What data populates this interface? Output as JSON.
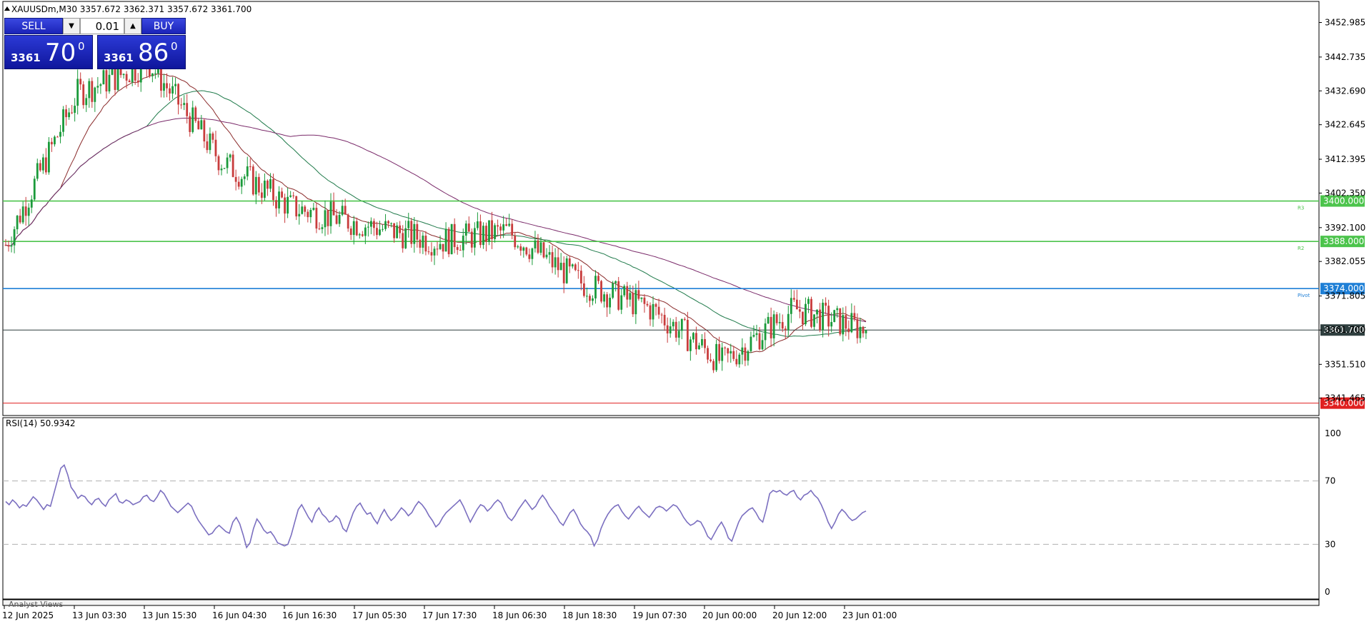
{
  "header": {
    "symbol_line": "XAUUSDm,M30  3357.672 3362.371 3357.672 3361.700",
    "collapse_icon": "triangle-up-icon"
  },
  "trade_panel": {
    "sell_label": "SELL",
    "buy_label": "BUY",
    "lot_value": "0.01",
    "sell_price_small": "3361",
    "sell_price_big": "70",
    "sell_price_sup": "0",
    "buy_price_small": "3361",
    "buy_price_big": "86",
    "buy_price_sup": "0"
  },
  "price_axis": {
    "ticks": [
      "3452.985",
      "3442.735",
      "3432.690",
      "3422.645",
      "3412.395",
      "3402.350",
      "3392.100",
      "3382.055",
      "3371.805",
      "3361.700",
      "3351.510",
      "3341.465"
    ],
    "tick_values": [
      3452.985,
      3442.735,
      3432.69,
      3422.645,
      3412.395,
      3402.35,
      3392.1,
      3382.055,
      3371.805,
      3361.7,
      3351.51,
      3341.465
    ]
  },
  "levels": [
    {
      "value": 3400.0,
      "label": "3400.000",
      "color": "#4cc44c",
      "tag": "R3"
    },
    {
      "value": 3388.0,
      "label": "3388.000",
      "color": "#4cc44c",
      "tag": "R2"
    },
    {
      "value": 3374.0,
      "label": "3374.000",
      "color": "#1e7fd6",
      "tag": "Pivot"
    },
    {
      "value": 3361.7,
      "label": "3361.700",
      "color": "#2f3f3f",
      "tag": ""
    },
    {
      "value": 3340.0,
      "label": "3340.000",
      "color": "#e02020",
      "tag": ""
    }
  ],
  "rsi": {
    "title": "RSI(14) 50.9342",
    "ticks": [
      "100",
      "70",
      "30",
      "0"
    ],
    "line_color": "#7b6fc0",
    "values": [
      57,
      55,
      58,
      56,
      53,
      55,
      54,
      57,
      60,
      58,
      55,
      52,
      55,
      54,
      62,
      70,
      78,
      80,
      74,
      66,
      63,
      59,
      61,
      60,
      57,
      55,
      58,
      59,
      56,
      54,
      58,
      60,
      62,
      57,
      56,
      58,
      57,
      55,
      56,
      57,
      60,
      61,
      58,
      57,
      60,
      64,
      62,
      58,
      54,
      52,
      50,
      52,
      54,
      56,
      54,
      49,
      45,
      42,
      39,
      36,
      37,
      40,
      42,
      40,
      38,
      37,
      44,
      47,
      43,
      36,
      28,
      31,
      40,
      46,
      43,
      39,
      37,
      38,
      35,
      31,
      30,
      29,
      30,
      36,
      44,
      52,
      55,
      51,
      47,
      44,
      50,
      53,
      49,
      47,
      44,
      45,
      48,
      46,
      40,
      38,
      44,
      50,
      54,
      56,
      52,
      49,
      50,
      46,
      43,
      48,
      52,
      48,
      45,
      47,
      50,
      53,
      51,
      48,
      50,
      54,
      57,
      55,
      52,
      48,
      45,
      41,
      43,
      47,
      50,
      52,
      54,
      56,
      58,
      54,
      49,
      44,
      48,
      52,
      55,
      54,
      51,
      53,
      56,
      58,
      56,
      51,
      47,
      45,
      48,
      52,
      55,
      58,
      55,
      52,
      54,
      58,
      61,
      58,
      54,
      51,
      48,
      44,
      42,
      46,
      50,
      52,
      48,
      43,
      40,
      38,
      35,
      29,
      33,
      40,
      45,
      49,
      52,
      54,
      55,
      51,
      48,
      46,
      49,
      52,
      54,
      51,
      49,
      47,
      50,
      53,
      54,
      53,
      51,
      53,
      55,
      54,
      51,
      47,
      44,
      42,
      43,
      45,
      44,
      40,
      35,
      33,
      37,
      41,
      44,
      40,
      34,
      32,
      38,
      44,
      48,
      50,
      52,
      53,
      50,
      46,
      44,
      52,
      62,
      64,
      63,
      64,
      62,
      61,
      63,
      64,
      60,
      58,
      61,
      62,
      64,
      61,
      59,
      55,
      50,
      44,
      40,
      44,
      49,
      52,
      50,
      47,
      45,
      46,
      48,
      50,
      51
    ],
    "last_value": 50.9342
  },
  "time_axis": {
    "labels": [
      "12 Jun 2025",
      "13 Jun 03:30",
      "13 Jun 15:30",
      "16 Jun 04:30",
      "16 Jun 16:30",
      "17 Jun 05:30",
      "17 Jun 17:30",
      "18 Jun 06:30",
      "18 Jun 18:30",
      "19 Jun 07:30",
      "20 Jun 00:00",
      "20 Jun 12:00",
      "23 Jun 01:00"
    ]
  },
  "bottom_tab": {
    "label": "Analyst Views"
  },
  "colors": {
    "bull_candle": "#1a9a3a",
    "bear_candle": "#c83c3c",
    "ma_fast": "#8a2a2a",
    "ma_mid": "#1f7a4a",
    "ma_slow": "#7a2a6a"
  },
  "chart_data": {
    "type": "candlestick",
    "symbol": "XAUUSDm",
    "timeframe": "M30",
    "last_close": 3361.7,
    "ylim": [
      3339.5,
      3455.0
    ],
    "key_points": [
      {
        "x": "12 Jun 2025",
        "y": 3387.0
      },
      {
        "x": "13 Jun 03:30",
        "y": 3432.0
      },
      {
        "x": "13 Jun 15:30",
        "y": 3441.0
      },
      {
        "x": "16 Jun 04:30",
        "y": 3412.0
      },
      {
        "x": "16 Jun 16:30",
        "y": 3398.0
      },
      {
        "x": "17 Jun 05:30",
        "y": 3393.0
      },
      {
        "x": "17 Jun 17:30",
        "y": 3388.0
      },
      {
        "x": "18 Jun 06:30",
        "y": 3391.0
      },
      {
        "x": "18 Jun 18:30",
        "y": 3376.0
      },
      {
        "x": "19 Jun 07:30",
        "y": 3368.0
      },
      {
        "x": "20 Jun 00:00",
        "y": 3352.0
      },
      {
        "x": "20 Jun 12:00",
        "y": 3368.0
      },
      {
        "x": "23 Jun 01:00",
        "y": 3361.7
      }
    ]
  }
}
